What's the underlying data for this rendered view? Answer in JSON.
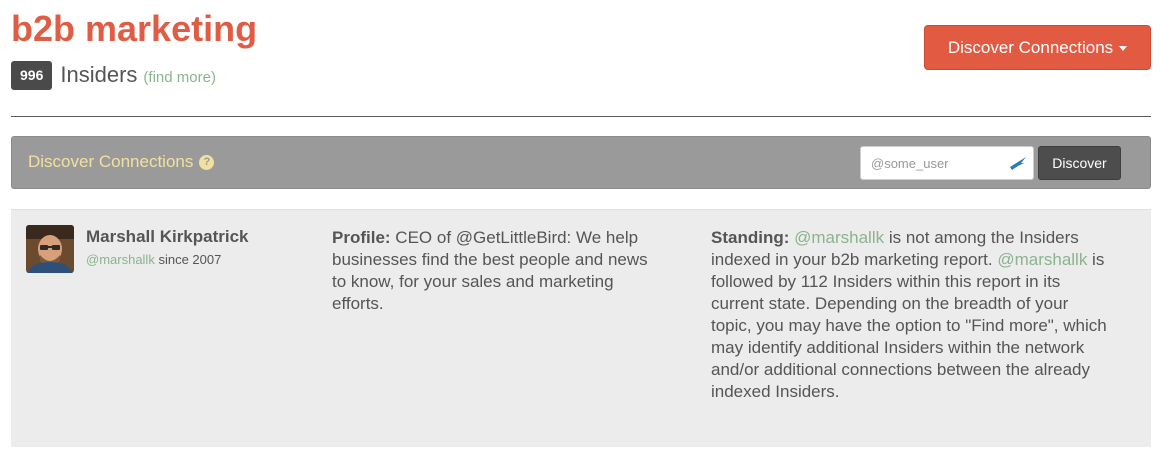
{
  "header": {
    "title": "b2b marketing",
    "insider_count": "996",
    "insiders_label": "Insiders",
    "find_more": "find more",
    "discover_button": "Discover Connections"
  },
  "discover_bar": {
    "title": "Discover Connections",
    "help_icon": "?",
    "search_placeholder": "@some_user",
    "search_value": "",
    "discover_button": "Discover"
  },
  "profile_card": {
    "name": "Marshall Kirkpatrick",
    "handle": "@marshallk",
    "since": "since 2007",
    "profile_label": "Profile:",
    "profile_text": "CEO of @GetLittleBird: We help businesses find the best people and news to know, for your sales and marketing efforts.",
    "standing_label": "Standing:",
    "standing_handle_1": "@marshallk",
    "standing_text_1": " is not among the Insiders indexed in your b2b marketing report. ",
    "standing_handle_2": "@marshallk",
    "standing_text_2": " is followed by 112 Insiders within this report in its current state. Depending on the breadth of your topic, you may have the option to \"Find more\", which may identify additional Insiders within the network and/or additional connections between the already indexed Insiders."
  },
  "colors": {
    "accent": "#e05d45",
    "link_green": "#8ab38f",
    "bar_gray": "#9a9a9a",
    "card_bg": "#ececec"
  }
}
